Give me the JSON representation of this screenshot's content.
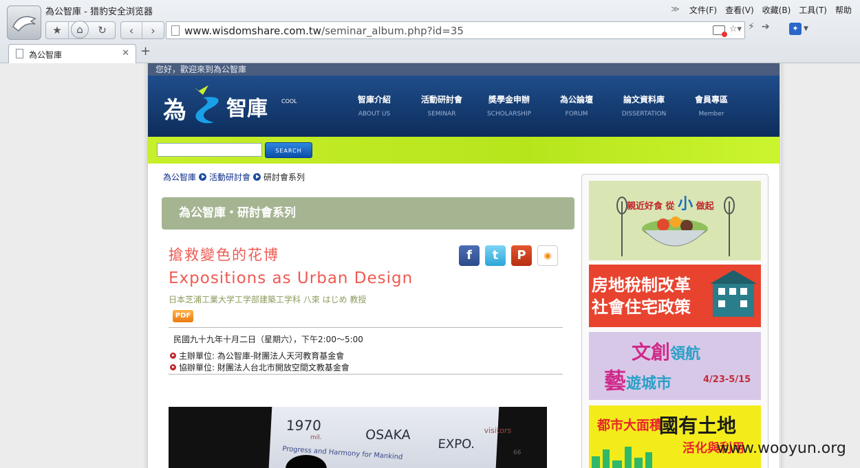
{
  "browser": {
    "window_title": "為公智庫 - 猎豹安全浏览器",
    "menu": [
      "文件(F)",
      "查看(V)",
      "收藏(B)",
      "工具(T)",
      "帮助"
    ],
    "url_main": "www.wisdomshare.com.tw",
    "url_path": "/seminar_album.php?id=35",
    "tab_title": "為公智庫",
    "new_tab_label": "+"
  },
  "site": {
    "welcome": "您好，歡迎來到為公智庫",
    "brand_text": "為公智庫",
    "brand_sub": "COOL",
    "nav": [
      {
        "zh": "智庫介紹",
        "en": "ABOUT US"
      },
      {
        "zh": "活動研討會",
        "en": "SEMINAR"
      },
      {
        "zh": "獎學金申辦",
        "en": "SCHOLARSHIP"
      },
      {
        "zh": "為公論壇",
        "en": "FORUM"
      },
      {
        "zh": "論文資料庫",
        "en": "DISSERTATION"
      },
      {
        "zh": "會員專區",
        "en": "Member"
      }
    ],
    "search_value": "",
    "search_button": "SEARCH"
  },
  "breadcrumb": {
    "home": "為公智庫",
    "section": "活動研討會",
    "current": "研討會系列"
  },
  "section_title": "為公智庫・研討會系列",
  "article": {
    "title_zh": "搶救變色的花博",
    "title_en": "Expositions as Urban Design",
    "author": "日本芝浦工業大学工学部建築工学科 八束 はじめ 教授",
    "pdf_label": "PDF",
    "date": "民國九十九年十月二日（星期六），下午2:00～5:00",
    "organizer": "主辦單位: 為公智庫-財團法人天河教育基金會",
    "co_organizer": "協辦單位: 財團法人台北市開放空間文教基金會"
  },
  "share": {
    "fb": "f",
    "tw": "t",
    "pl": "P",
    "rss": "◉"
  },
  "photo_screen": {
    "year": "1970",
    "mil": "mil.",
    "osaka": "OSAKA",
    "expo": "EXPO.",
    "visitors": "visitors",
    "num": "66",
    "theme": "Progress and Harmony for Mankind"
  },
  "ads": {
    "ad1": {
      "pre": "親近好食 從",
      "big": "小",
      "post": "做起"
    },
    "ad2": {
      "line1": "房地稅制改革",
      "line2": "社會住宅政策"
    },
    "ad3": {
      "big": "文創",
      "small": "領航",
      "big2": "藝",
      "small2": "遊城市",
      "date": "4/23-5/15"
    },
    "ad4": {
      "pre": "都市大面積",
      "big": "國有土地",
      "post": "活化與利用"
    }
  },
  "watermark": "www.wooyun.org",
  "colors": {
    "header": "#0d2d5c",
    "search_bar": "#c7ef2a",
    "title_red": "#ee5a52",
    "section_green": "#a5b592"
  }
}
